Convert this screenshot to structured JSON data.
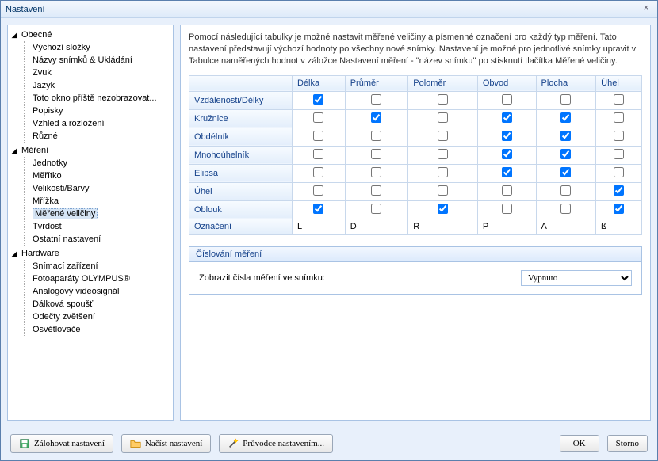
{
  "window": {
    "title": "Nastavení"
  },
  "sidebar": {
    "groups": [
      {
        "label": "Obecné",
        "expanded": true,
        "items": [
          {
            "label": "Výchozí složky"
          },
          {
            "label": "Názvy snímků & Ukládání"
          },
          {
            "label": "Zvuk"
          },
          {
            "label": "Jazyk"
          },
          {
            "label": "Toto okno příště nezobrazovat..."
          },
          {
            "label": "Popisky"
          },
          {
            "label": "Vzhled a rozložení"
          },
          {
            "label": "Různé"
          }
        ]
      },
      {
        "label": "Měření",
        "expanded": true,
        "items": [
          {
            "label": "Jednotky"
          },
          {
            "label": "Měřítko"
          },
          {
            "label": "Velikosti/Barvy"
          },
          {
            "label": "Mřížka"
          },
          {
            "label": "Měřené veličiny",
            "selected": true
          },
          {
            "label": "Tvrdost"
          },
          {
            "label": "Ostatní nastavení"
          }
        ]
      },
      {
        "label": "Hardware",
        "expanded": true,
        "items": [
          {
            "label": "Snímací zařízení"
          },
          {
            "label": "Fotoaparáty OLYMPUS®"
          },
          {
            "label": "Analogový videosignál"
          },
          {
            "label": "Dálková spoušť"
          },
          {
            "label": "Odečty zvětšení"
          },
          {
            "label": "Osvětlovače"
          }
        ]
      }
    ]
  },
  "content": {
    "description": "Pomocí následující tabulky je možné nastavit měřené veličiny a písmenné označení pro každý typ měření. Tato nastavení představují výchozí hodnoty po všechny nové snímky. Nastavení je možné pro jednotlivé snímky upravit v Tabulce naměřených hodnot v záložce Nastavení měření - \"název snímku\" po stisknutí tlačítka Měřené veličiny.",
    "columns": [
      "",
      "Délka",
      "Průměr",
      "Poloměr",
      "Obvod",
      "Plocha",
      "Úhel"
    ],
    "rows": [
      {
        "label": "Vzdálenosti/Délky",
        "cells": [
          true,
          false,
          false,
          false,
          false,
          false
        ]
      },
      {
        "label": "Kružnice",
        "cells": [
          false,
          true,
          false,
          true,
          true,
          false
        ]
      },
      {
        "label": "Obdélník",
        "cells": [
          false,
          false,
          false,
          true,
          true,
          false
        ]
      },
      {
        "label": "Mnohoúhelník",
        "cells": [
          false,
          false,
          false,
          true,
          true,
          false
        ]
      },
      {
        "label": "Elipsa",
        "cells": [
          false,
          false,
          false,
          true,
          true,
          false
        ]
      },
      {
        "label": "Úhel",
        "cells": [
          false,
          false,
          false,
          false,
          false,
          true
        ]
      },
      {
        "label": "Oblouk",
        "cells": [
          true,
          false,
          true,
          false,
          false,
          true
        ]
      }
    ],
    "labelsRow": {
      "label": "Označení",
      "cells": [
        "L",
        "D",
        "R",
        "P",
        "A",
        "ß"
      ]
    },
    "numbering": {
      "title": "Číslování měření",
      "label": "Zobrazit čísla měření ve snímku:",
      "value": "Vypnuto"
    }
  },
  "footer": {
    "backup": "Zálohovat nastavení",
    "load": "Načíst nastavení",
    "wizard": "Průvodce nastavením...",
    "ok": "OK",
    "cancel": "Storno"
  }
}
